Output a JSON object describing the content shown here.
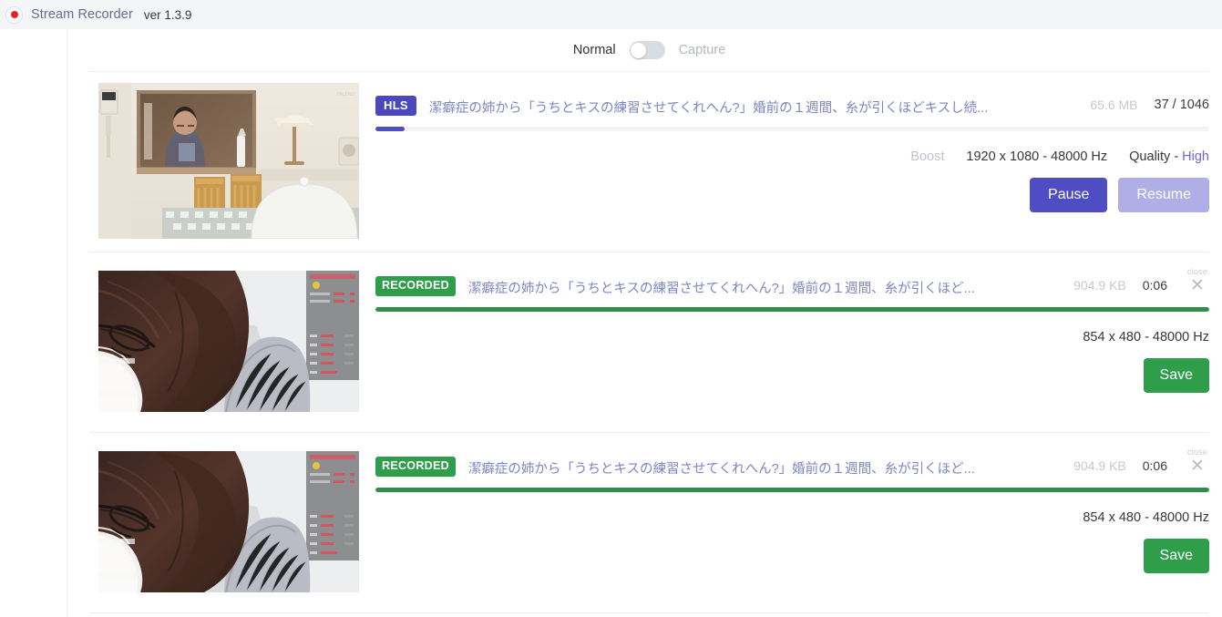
{
  "header": {
    "record_icon": "record-dot-icon",
    "app_name": "Stream Recorder",
    "version": "ver 1.3.9"
  },
  "mode_switch": {
    "left_label": "Normal",
    "right_label": "Capture",
    "state": "off",
    "active": "Normal"
  },
  "colors": {
    "indigo": "#4f4dc4",
    "indigo_faded": "#b0aee6",
    "green": "#2e9e4b",
    "title_text": "#7c85c4",
    "muted": "#c5c8cd",
    "header_bg": "#f4f5f7"
  },
  "downloads": [
    {
      "badge": "HLS",
      "badge_type": "hls",
      "title": "潔癖症の姉から「うちとキスの練習させてくれへん?」婚前の１週間、糸が引くほどキスし続...",
      "size": "65.6 MB",
      "counter": "37 / 1046",
      "progress_percent": 3.5,
      "progress_color": "indigo",
      "boost_label": "Boost",
      "boost_enabled": false,
      "resolution": "1920 x 1080 - 48000 Hz",
      "quality_label": "Quality - ",
      "quality_value": "High",
      "buttons": [
        {
          "label": "Pause",
          "style": "pause",
          "enabled": true
        },
        {
          "label": "Resume",
          "style": "resume",
          "enabled": false
        }
      ],
      "thumbnail": "room-with-mirror-thumbnail"
    },
    {
      "badge": "RECORDED",
      "badge_type": "recorded",
      "title": "潔癖症の姉から「うちとキスの練習させてくれへん?」婚前の１週間、糸が引くほど...",
      "size": "904.9 KB",
      "duration": "0:06",
      "close_tooltip": "close",
      "close_icon": "close-x-icon",
      "progress_percent": 100,
      "progress_color": "green",
      "resolution": "854 x 480 - 48000 Hz",
      "buttons": [
        {
          "label": "Save",
          "style": "save",
          "enabled": true
        }
      ],
      "thumbnail": "person-with-mask-thumbnail"
    },
    {
      "badge": "RECORDED",
      "badge_type": "recorded",
      "title": "潔癖症の姉から「うちとキスの練習させてくれへん?」婚前の１週間、糸が引くほど...",
      "size": "904.9 KB",
      "duration": "0:06",
      "close_tooltip": "close",
      "close_icon": "close-x-icon",
      "progress_percent": 100,
      "progress_color": "green",
      "resolution": "854 x 480 - 48000 Hz",
      "buttons": [
        {
          "label": "Save",
          "style": "save",
          "enabled": true
        }
      ],
      "thumbnail": "person-with-mask-thumbnail"
    }
  ]
}
